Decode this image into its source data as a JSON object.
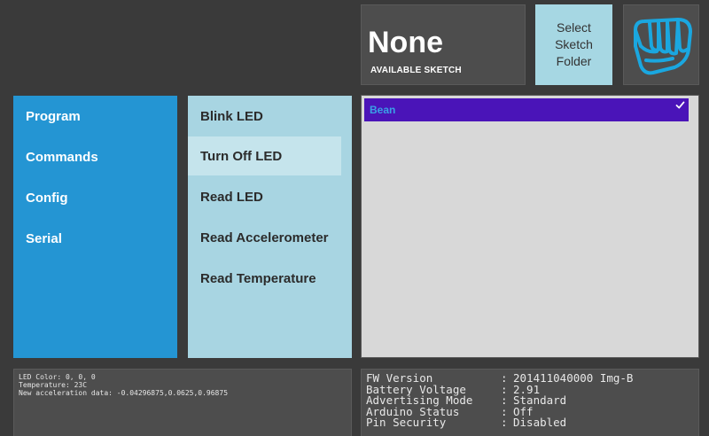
{
  "sketch": {
    "name": "None",
    "label": "AVAILABLE SKETCH"
  },
  "select_folder": {
    "line1": "Select",
    "line2": "Sketch",
    "line3": "Folder"
  },
  "logo": {
    "icon": "fist-icon",
    "color": "#1aa7e0"
  },
  "nav": {
    "items": [
      {
        "label": "Program"
      },
      {
        "label": "Commands"
      },
      {
        "label": "Config"
      },
      {
        "label": "Serial"
      }
    ]
  },
  "commands": {
    "items": [
      {
        "label": "Blink LED",
        "selected": false
      },
      {
        "label": "Turn Off LED",
        "selected": true
      },
      {
        "label": "Read LED",
        "selected": false
      },
      {
        "label": "Read Accelerometer",
        "selected": false
      },
      {
        "label": "Read Temperature",
        "selected": false
      }
    ]
  },
  "devices": {
    "items": [
      {
        "label": "Bean",
        "checked": true
      }
    ]
  },
  "log": {
    "lines": [
      "LED Color: 0, 0, 0",
      "Temperature: 23C",
      "New acceleration data: -0.04296875,0.0625,0.96875"
    ]
  },
  "status": {
    "separator": ":",
    "rows": [
      {
        "key": "FW Version",
        "value": "201411040000 Img-B"
      },
      {
        "key": "Battery Voltage",
        "value": "2.91"
      },
      {
        "key": "Advertising Mode",
        "value": "Standard"
      },
      {
        "key": "Arduino Status",
        "value": "Off"
      },
      {
        "key": "Pin Security",
        "value": "Disabled"
      }
    ]
  },
  "colors": {
    "background": "#3a3a3a",
    "nav": "#2495d3",
    "commands": "#a8d5e2",
    "selected_command": "#c5e4ec",
    "list_bg": "#d8d8d8",
    "list_selected": "#4a14b8",
    "select_folder": "#a6d7e3"
  }
}
